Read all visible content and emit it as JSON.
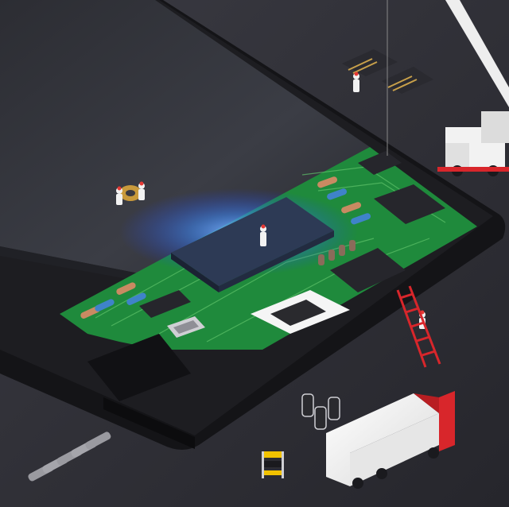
{
  "scene": {
    "kind": "product-photo",
    "subject": "power-bank-cutaway",
    "colors": {
      "background": "#2f2f36",
      "shell": "#18181b",
      "battery": "#34363d",
      "pcb": "#1f8a3c",
      "pcb_trace": "#5fc36a",
      "chip": "#27272c",
      "glow": "#3f8bff",
      "truck_cab": "#d8262b",
      "truck_box": "#f2f2f2",
      "crane": "#eeeeee",
      "ladder": "#d8262b",
      "usb_port": "#f5f5f5"
    },
    "icons": {
      "power_bank": "power-bank-icon",
      "battery_pack": "battery-pack-icon",
      "circuit_board": "circuit-board-icon",
      "usb_port": "usb-a-port-icon",
      "lightning_port": "lightning-port-icon",
      "truck": "truck-icon",
      "crane": "crane-icon",
      "ladder": "ladder-icon",
      "workers": "worker-figure-icon",
      "barrier": "safety-barrier-icon",
      "capacitors": "capacitor-icon",
      "screws": "screw-icon",
      "coil": "inductor-coil-icon",
      "floating_chip": "microchip-icon"
    }
  }
}
